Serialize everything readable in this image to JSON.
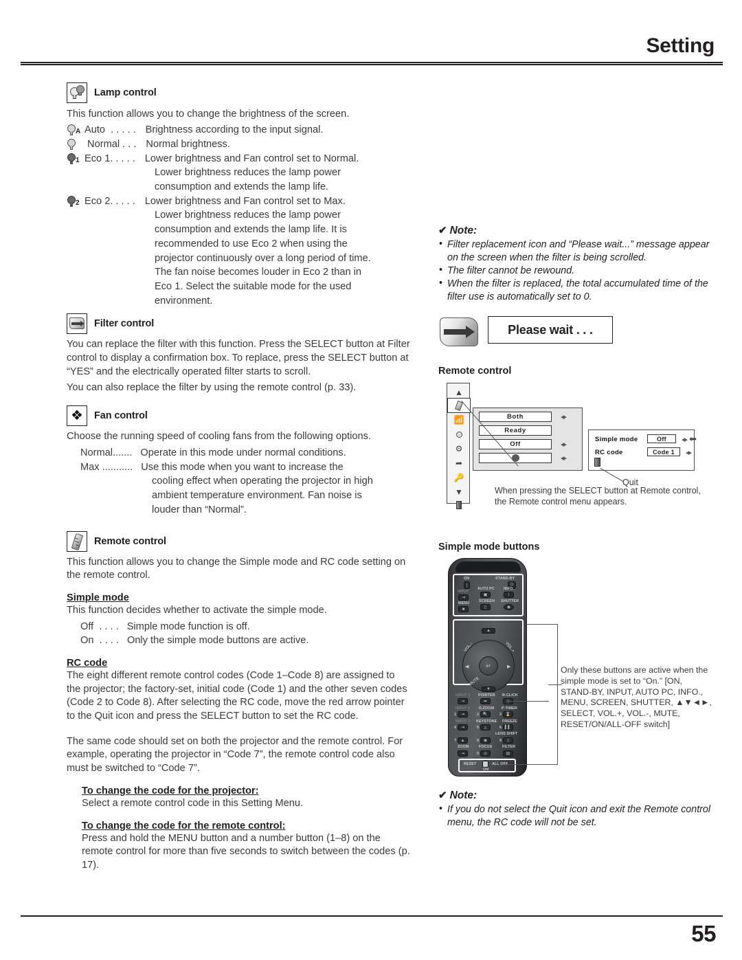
{
  "header": {
    "title": "Setting"
  },
  "footer": {
    "page_number": "55"
  },
  "left": {
    "lamp": {
      "icon": "lamp-control-icon",
      "title": "Lamp control",
      "intro": "This function allows you to change the brightness of the screen.",
      "options": [
        {
          "icon": "bulb-auto-icon",
          "term": "Auto  . . . . .",
          "desc": "Brightness according to the input signal.",
          "cont": []
        },
        {
          "icon": "bulb-normal-icon",
          "term": " Normal . . .",
          "desc": "Normal brightness.",
          "cont": []
        },
        {
          "icon": "bulb-eco1-icon",
          "term": "Eco 1. . . . .",
          "desc": "Lower brightness and Fan control set to Normal.",
          "cont": [
            "Lower brightness reduces the lamp power",
            "consumption and extends the lamp life."
          ]
        },
        {
          "icon": "bulb-eco2-icon",
          "term": "Eco 2. . . . .",
          "desc": "Lower brightness and Fan control set to Max.",
          "cont": [
            "Lower brightness reduces the lamp power",
            "consumption and extends the lamp life. It is",
            "recommended to use Eco 2 when using the",
            "projector continuously over a long period of time.",
            "The fan noise becomes louder in Eco 2 than in",
            "Eco 1. Select the suitable mode for the used",
            "environment."
          ]
        }
      ]
    },
    "filter": {
      "icon": "filter-control-icon",
      "title": "Filter control",
      "p1": "You can replace the filter with this function. Press the SELECT button at Filter control to display a confirmation box. To replace, press the SELECT button at “YES” and the electrically operated filter starts to scroll.",
      "p2": "You can also replace the filter by using the remote control (p. 33)."
    },
    "fan": {
      "icon": "fan-control-icon",
      "title": "Fan control",
      "intro": "Choose the running speed of cooling fans from the following options.",
      "options": [
        {
          "term": "Normal.......",
          "desc": "Operate in this mode under normal conditions.",
          "cont": []
        },
        {
          "term": "Max ...........",
          "desc": "Use this mode when you want to increase the",
          "cont": [
            "cooling effect when operating the projector in high",
            "ambient temperature environment. Fan noise is",
            "louder than “Normal”."
          ]
        }
      ]
    },
    "remote": {
      "icon": "remote-control-icon",
      "title": "Remote control",
      "intro": "This function allows you to change the Simple mode and RC code setting on the remote control.",
      "simple_mode": {
        "heading": "Simple mode",
        "intro": "This function decides whether to activate the simple mode.",
        "options": [
          {
            "term": "Off  . . . .",
            "desc": "Simple mode function is off."
          },
          {
            "term": "On  . . . .",
            "desc": "Only the simple mode buttons are active."
          }
        ]
      },
      "rc_code": {
        "heading": "RC code",
        "p1": "The eight different remote control codes (Code 1–Code 8) are assigned to the projector; the factory-set, initial code (Code 1) and the other seven codes (Code 2 to Code 8). After selecting the RC code, move the red arrow pointer to the Quit icon and press the SELECT button to set the RC code.",
        "p2": "The same code should set on both the projector and the remote control. For example, operating the projector in “Code 7”, the remote control code also must be switched to “Code 7”.",
        "proj": {
          "heading": "To change the code for the projector:",
          "text": "Select a remote control code in this Setting Menu."
        },
        "rc": {
          "heading": "To change the code for the remote control:",
          "text": "Press and hold the MENU button and a number button (1–8) on the remote control for more than five seconds to switch between the codes (p. 17)."
        }
      }
    }
  },
  "right": {
    "note1": {
      "title": "Note:",
      "items": [
        "Filter replacement icon and “Please wait...” message appear on the screen when the filter is being scrolled.",
        "The filter cannot be rewound.",
        "When the filter is replaced, the total accumulated time of the filter use is automatically set to 0."
      ]
    },
    "please_wait": {
      "icon": "filter-replacement-icon",
      "label": "Please wait . . ."
    },
    "rc_menu": {
      "title": "Remote control",
      "sidebar_icons": [
        "scroll-up-icon",
        "remote-control-icon",
        "ir-receiver-icon",
        "lamp-icon",
        "filter-icon",
        "pointer-icon",
        "key-lock-icon",
        "scroll-down-icon",
        "quit-icon"
      ],
      "fields": [
        {
          "value": "Both",
          "has_arrows": true
        },
        {
          "value": "Ready",
          "has_arrows": false
        },
        {
          "value": "Off",
          "has_arrows": true
        },
        {
          "value": "",
          "has_arrows": true,
          "is_dot": true
        }
      ],
      "submenu": {
        "rows": [
          {
            "label": "Simple mode",
            "value": "Off",
            "pointer": true
          },
          {
            "label": "RC code",
            "value": "Code 1",
            "pointer": false
          }
        ],
        "quit_icon": "quit-icon",
        "quit_label": "Quit"
      },
      "caption": "When pressing the SELECT button at Remote control, the Remote control menu appears."
    },
    "simple_mode_buttons": {
      "title": "Simple mode buttons",
      "remote_labels": {
        "on": "ON",
        "standby": "STAND-BY",
        "input": "INPUT",
        "auto_pc": "AUTO PC",
        "info": "INFO.",
        "menu": "MENU",
        "screen": "SCREEN",
        "shutter": "SHUTTER",
        "vol_minus": "VOL.-",
        "vol_plus": "VOL.+",
        "mute": "MUTE",
        "input1": "INPUT 1",
        "pointer": "POINTER",
        "r_click": "R-CLICK",
        "input2": "INPUT 2",
        "d_zoom": "D.ZOOM",
        "p_timer": "P-TIMER",
        "input3": "INPUT 3",
        "keystone": "KEYSTONE",
        "freeze": "FREEZE",
        "lens_shift": "LENS SHIFT",
        "zoom": "ZOOM",
        "focus": "FOCUS",
        "filter": "FILTER",
        "reset": "RESET",
        "all_off": "ALL OFF",
        "on_switch": "ON",
        "nums": [
          "1",
          "2",
          "3",
          "4",
          "5",
          "6",
          "7",
          "8",
          "9",
          "0"
        ]
      },
      "note": "Only these buttons are active when the simple mode is set to “On.” [ON, STAND-BY, INPUT, AUTO PC, INFO., MENU, SCREEN, SHUTTER, ▲▼◄►, SELECT, VOL.+, VOL.-, MUTE, RESET/ON/ALL-OFF switch]"
    },
    "note2": {
      "title": "Note:",
      "items": [
        "If you do not select the Quit icon and exit the Remote control menu, the RC code will not be set."
      ]
    }
  }
}
